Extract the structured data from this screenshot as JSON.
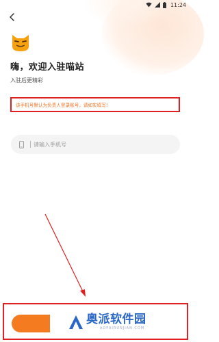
{
  "status_bar": {
    "time": "11:24",
    "icons": [
      "wifi-icon",
      "signal-icon",
      "battery-icon"
    ]
  },
  "nav": {
    "back_icon": "back-arrow-icon"
  },
  "header": {
    "logo_icon": "cat-face-logo",
    "title": "嗨，欢迎入驻喵站",
    "subtitle": "入驻后更精彩"
  },
  "notice": {
    "text": "该手机号默认为负责人登录账号，请如实填写!"
  },
  "phone_field": {
    "icon": "phone-icon",
    "value": "",
    "placeholder": "请输入手机号"
  },
  "footer": {
    "submit_button": ""
  },
  "watermark": {
    "title": "奥派软件园",
    "url": "AOPAIRUNJIAN.COM"
  },
  "colors": {
    "accent": "#f47b20",
    "highlight_border": "#e02020",
    "notice_text": "#f07020",
    "watermark": "#2a67c7"
  }
}
